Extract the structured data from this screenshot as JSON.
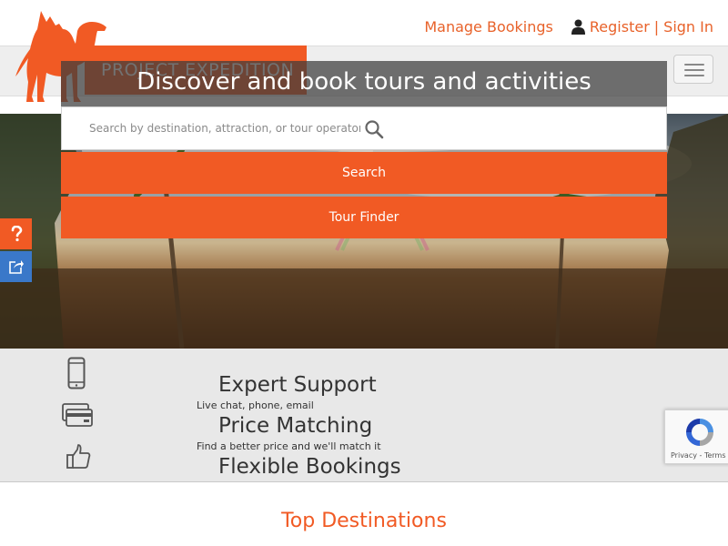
{
  "header": {
    "manage_bookings": "Manage Bookings",
    "register": "Register",
    "separator": "|",
    "sign_in": "Sign In",
    "logo_text": "PROJECT EXPEDITION"
  },
  "hero": {
    "title": "Discover and book tours and activities",
    "search_placeholder": "Search by destination, attraction, or tour operator",
    "search_button": "Search",
    "tour_finder_button": "Tour Finder"
  },
  "side_tabs": [
    {
      "icon": "question-icon"
    },
    {
      "icon": "share-icon"
    }
  ],
  "features": [
    {
      "icon": "smartphone-icon",
      "title": "Expert Support",
      "subtitle": "Live chat, phone, email"
    },
    {
      "icon": "credit-card-icon",
      "title": "Price Matching",
      "subtitle": "Find a better price and we'll match it"
    },
    {
      "icon": "thumbs-up-icon",
      "title": "Flexible Bookings",
      "subtitle": ""
    }
  ],
  "recaptcha": {
    "privacy": "Privacy",
    "dash": "-",
    "terms": "Terms"
  },
  "sections": {
    "top_destinations": "Top Destinations"
  },
  "colors": {
    "brand_orange": "#f15a24",
    "link_orange": "#e8622a",
    "share_blue": "#3a78c9"
  }
}
